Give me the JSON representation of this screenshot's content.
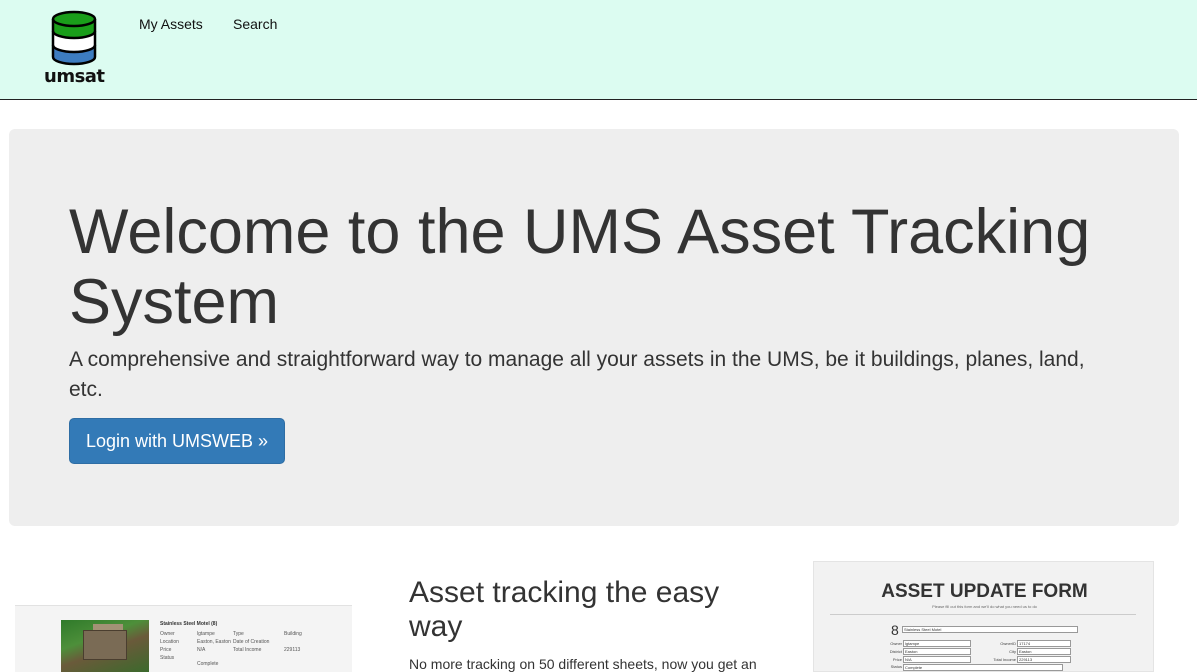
{
  "brand": {
    "logo_text": "umsat",
    "colors": {
      "green": "#1a9e1a",
      "blue": "#3d7cc0",
      "navbar_bg": "#dcfcf1",
      "button": "#337ab7"
    }
  },
  "nav": {
    "items": [
      {
        "label": "My Assets"
      },
      {
        "label": "Search"
      }
    ]
  },
  "hero": {
    "title": "Welcome to the UMS Asset Tracking System",
    "lead": "A comprehensive and straightforward way to manage all your assets in the UMS, be it buildings, planes, land, etc.",
    "login_label": "Login with UMSWEB »"
  },
  "feature": {
    "heading": "Asset tracking the easy way",
    "text": "No more tracking on 50 different sheets, now you get an"
  },
  "preview_left": {
    "title": "Stainless Steel Motel (8)",
    "rows": [
      {
        "k1": "Owner",
        "v1": "lgtampe",
        "k2": "Type",
        "v2": "Building"
      },
      {
        "k1": "Location",
        "v1": "Easton, Easton",
        "k2": "Date of Creation",
        "v2": ""
      },
      {
        "k1": "Price",
        "v1": "N/A",
        "k2": "Total Income",
        "v2": "229113"
      },
      {
        "k1": "Status",
        "v1": "",
        "k2": "",
        "v2": ""
      }
    ],
    "status_value": "Complete"
  },
  "preview_right": {
    "title": "ASSET UPDATE FORM",
    "subtitle": "Please fill out this form and we'll do what you need us to do",
    "number": "8",
    "name_value": "Stainless Steel Motel",
    "fields": {
      "owner_label": "Owner",
      "owner_value": "lgtampe",
      "district_label": "District",
      "district_value": "Easton",
      "price_label": "Price",
      "price_value": "N/A",
      "status_label": "Status",
      "status_value": "Complete",
      "ownerid_label": "OwnerID",
      "ownerid_value": "17174",
      "city_label": "City",
      "city_value": "Easton",
      "income_label": "Total Income",
      "income_value": "229113"
    }
  }
}
